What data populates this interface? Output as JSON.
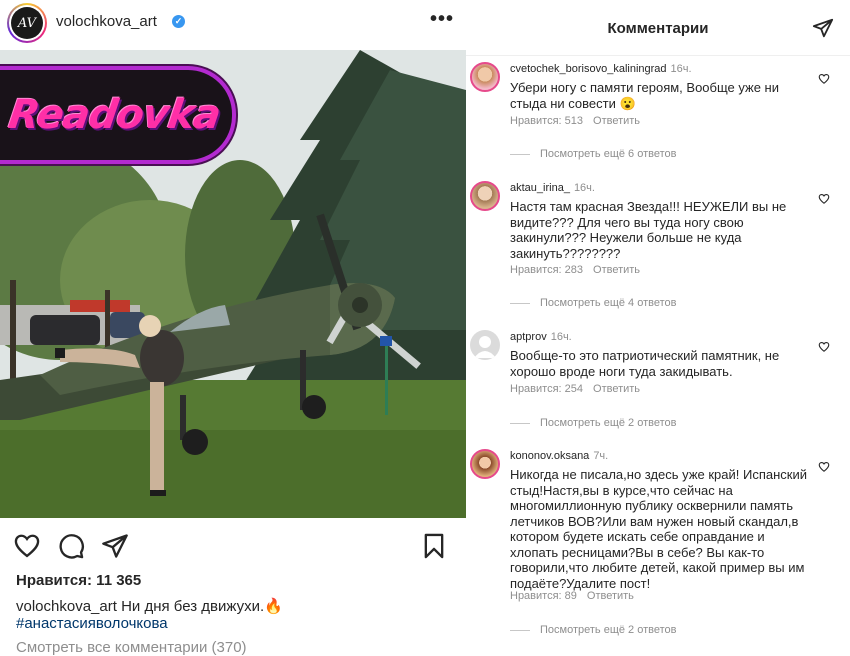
{
  "post": {
    "username": "volochkova_art",
    "overlay_logo_text": "Readovka",
    "likes_text": "Нравится: 11 365",
    "caption_user": "volochkova_art",
    "caption_text": "Ни дня без движухи.🔥",
    "hashtag": "#анастасияволочкова",
    "view_all": "Смотреть все комментарии (370)",
    "icons": [
      "heart-icon",
      "comment-icon",
      "share-icon",
      "bookmark-icon",
      "more-icon",
      "verified-icon"
    ]
  },
  "comments_panel": {
    "title": "Комментарии",
    "comments": [
      {
        "user": "cvetochek_borisovo_kaliningrad",
        "time": "16ч.",
        "text": "Убери ногу с памяти героям, Вообще уже ни стыда ни совести 😮",
        "likes": "Нравится: 513",
        "reply": "Ответить",
        "more": "Посмотреть ещё 6 ответов"
      },
      {
        "user": "aktau_irina_",
        "time": "16ч.",
        "text": "Настя там красная Звезда!!! НЕУЖЕЛИ вы не видите??? Для чего вы туда ногу свою закинули??? Неужели больше не куда закинуть????????",
        "likes": "Нравится: 283",
        "reply": "Ответить",
        "more": "Посмотреть ещё 4 ответов"
      },
      {
        "user": "aptprov",
        "time": "16ч.",
        "text": "Вообще-то это патриотический памятник, не хорошо вроде  ноги туда закидывать.",
        "likes": "Нравится: 254",
        "reply": "Ответить",
        "more": "Посмотреть ещё 2 ответов"
      },
      {
        "user": "kononov.oksana",
        "time": "7ч.",
        "text": "Никогда не писала,но здесь уже край! Испанский стыд!Настя,вы в курсе,что сейчас на многомиллионную публику осквернили память летчиков ВОВ?Или вам нужен новый скандал,в котором будете искать себе оправдание и хлопать ресницами?Вы в себе? Вы как-то говорили,что любите детей, какой пример вы им подаёте?Удалите пост!",
        "likes": "Нравится: 89",
        "reply": "Ответить",
        "more": "Посмотреть ещё 2 ответов"
      }
    ]
  },
  "colors": {
    "text": "#262626",
    "muted": "#8e8e8e",
    "link": "#00376b",
    "verified": "#3897f0",
    "logo_pink": "#ff2fa7",
    "logo_border": "#b32ad0"
  }
}
